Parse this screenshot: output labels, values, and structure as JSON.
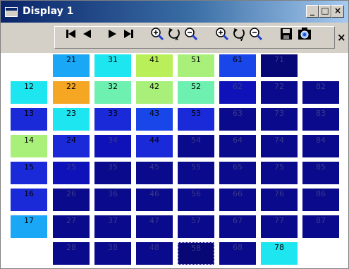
{
  "window": {
    "title": "Display 1",
    "buttons": {
      "minimize": "_",
      "maximize": "□",
      "close": "×"
    }
  },
  "toolbar": {
    "buttons": [
      "first-frame-icon",
      "previous-frame-icon",
      "next-frame-icon",
      "last-frame-icon",
      "zoom-in-x-icon",
      "reset-zoom-x-icon",
      "zoom-out-x-icon",
      "zoom-in-y-icon",
      "reset-zoom-y-icon",
      "zoom-out-y-icon",
      "save-icon",
      "camera-icon"
    ],
    "close_label": "×"
  },
  "colors": {
    "light_blue": "#1aa7f5",
    "cyan": "#1ee6f0",
    "yellow_green": "#b9f05a",
    "light_green": "#a8f07a",
    "mint": "#6ef0b0",
    "orange": "#f5a623",
    "blue": "#1846e8",
    "royal_blue": "#1a2ad8",
    "medium_blue": "#0e12b8",
    "navy": "#0a0a8c",
    "dark_navy": "#070775"
  },
  "grid": {
    "cells": [
      {
        "label": "21",
        "color": "light_blue"
      },
      {
        "label": "31",
        "color": "cyan"
      },
      {
        "label": "41",
        "color": "yellow_green"
      },
      {
        "label": "51",
        "color": "light_green"
      },
      {
        "label": "61",
        "color": "blue"
      },
      {
        "label": "71",
        "color": "dark_navy"
      },
      {
        "label": "12",
        "color": "cyan"
      },
      {
        "label": "22",
        "color": "orange"
      },
      {
        "label": "32",
        "color": "mint"
      },
      {
        "label": "42",
        "color": "light_green"
      },
      {
        "label": "52",
        "color": "mint"
      },
      {
        "label": "62",
        "color": "medium_blue"
      },
      {
        "label": "72",
        "color": "navy"
      },
      {
        "label": "82",
        "color": "navy"
      },
      {
        "label": "13",
        "color": "royal_blue"
      },
      {
        "label": "23",
        "color": "cyan"
      },
      {
        "label": "33",
        "color": "royal_blue"
      },
      {
        "label": "43",
        "color": "blue"
      },
      {
        "label": "53",
        "color": "royal_blue"
      },
      {
        "label": "63",
        "color": "navy"
      },
      {
        "label": "73",
        "color": "navy"
      },
      {
        "label": "83",
        "color": "navy"
      },
      {
        "label": "14",
        "color": "light_green"
      },
      {
        "label": "24",
        "color": "royal_blue"
      },
      {
        "label": "34",
        "color": "medium_blue"
      },
      {
        "label": "44",
        "color": "royal_blue"
      },
      {
        "label": "54",
        "color": "navy"
      },
      {
        "label": "64",
        "color": "navy"
      },
      {
        "label": "74",
        "color": "navy"
      },
      {
        "label": "84",
        "color": "navy"
      },
      {
        "label": "15",
        "color": "royal_blue"
      },
      {
        "label": "25",
        "color": "medium_blue"
      },
      {
        "label": "35",
        "color": "navy"
      },
      {
        "label": "45",
        "color": "navy"
      },
      {
        "label": "55",
        "color": "navy"
      },
      {
        "label": "65",
        "color": "navy"
      },
      {
        "label": "75",
        "color": "navy"
      },
      {
        "label": "85",
        "color": "navy"
      },
      {
        "label": "16",
        "color": "royal_blue"
      },
      {
        "label": "26",
        "color": "navy"
      },
      {
        "label": "36",
        "color": "navy"
      },
      {
        "label": "46",
        "color": "navy"
      },
      {
        "label": "56",
        "color": "navy"
      },
      {
        "label": "66",
        "color": "navy"
      },
      {
        "label": "76",
        "color": "navy"
      },
      {
        "label": "86",
        "color": "navy"
      },
      {
        "label": "17",
        "color": "light_blue"
      },
      {
        "label": "27",
        "color": "navy"
      },
      {
        "label": "37",
        "color": "navy"
      },
      {
        "label": "47",
        "color": "navy"
      },
      {
        "label": "57",
        "color": "navy"
      },
      {
        "label": "67",
        "color": "navy"
      },
      {
        "label": "77",
        "color": "navy"
      },
      {
        "label": "87",
        "color": "navy"
      },
      {
        "label": "28",
        "color": "navy"
      },
      {
        "label": "38",
        "color": "navy"
      },
      {
        "label": "48",
        "color": "navy"
      },
      {
        "label": "58",
        "color": "dark_navy"
      },
      {
        "label": "68",
        "color": "navy"
      },
      {
        "label": "78",
        "color": "cyan"
      }
    ]
  }
}
